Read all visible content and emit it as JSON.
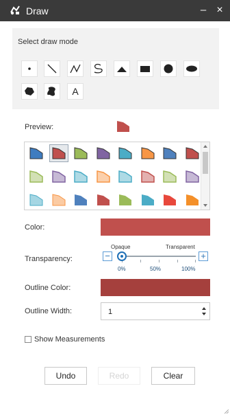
{
  "window": {
    "title": "Draw",
    "minimize_glyph": "–",
    "close_glyph": "×",
    "app_icon": "draw-widget-icon"
  },
  "draw_mode": {
    "label": "Select draw mode",
    "tools": [
      {
        "name": "point",
        "icon": "point-icon"
      },
      {
        "name": "line",
        "icon": "line-icon"
      },
      {
        "name": "polyline",
        "icon": "polyline-icon"
      },
      {
        "name": "freehand-polyline",
        "icon": "freehand-line-icon"
      },
      {
        "name": "triangle",
        "icon": "triangle-icon"
      },
      {
        "name": "rectangle",
        "icon": "rectangle-icon"
      },
      {
        "name": "circle",
        "icon": "circle-icon"
      },
      {
        "name": "ellipse",
        "icon": "ellipse-icon"
      },
      {
        "name": "polygon",
        "icon": "polygon-icon"
      },
      {
        "name": "freehand-polygon",
        "icon": "freehand-polygon-icon"
      },
      {
        "name": "text",
        "icon": "text-icon",
        "glyph": "A"
      }
    ]
  },
  "preview": {
    "label": "Preview:",
    "color": "#c0504d"
  },
  "palette": {
    "selected_index": 1,
    "colors": [
      "#3e7cc0",
      "#c0504d",
      "#9bbb59",
      "#8064a2",
      "#4bacc6",
      "#f79646",
      "#4f81bd",
      "#c0504d",
      "#9bbb59",
      "#8064a2",
      "#4bacc6",
      "#f79646",
      "#4bacc6",
      "#c0504d",
      "#9bbb59",
      "#8064a2",
      "#4bacc6",
      "#f79646",
      "#4f81bd",
      "#c0504d",
      "#9bbb59",
      "#4bacc6",
      "#e8483c",
      "#f4902a"
    ]
  },
  "color": {
    "label": "Color:",
    "value": "#c0504d"
  },
  "transparency": {
    "label": "Transparency:",
    "opaque_label": "Opaque",
    "transparent_label": "Transparent",
    "minus": "−",
    "plus": "+",
    "ticks": [
      "0%",
      "50%",
      "100%"
    ],
    "value_percent": 0
  },
  "outline_color": {
    "label": "Outline Color:",
    "value": "#a5403d"
  },
  "outline_width": {
    "label": "Outline Width:",
    "value": "1"
  },
  "show_measurements": {
    "label": "Show Measurements",
    "checked": false
  },
  "actions": {
    "undo": "Undo",
    "redo": "Redo",
    "clear": "Clear"
  }
}
